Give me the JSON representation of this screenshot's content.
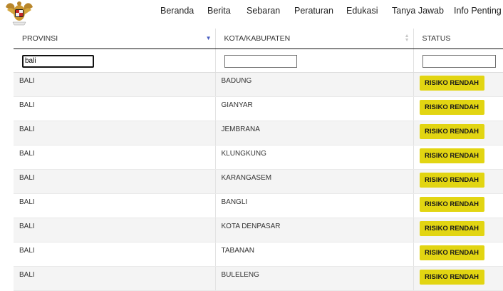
{
  "nav": {
    "items": [
      "Beranda",
      "Berita",
      "Sebaran",
      "Peraturan",
      "Edukasi",
      "Tanya Jawab",
      "Info Penting"
    ]
  },
  "table": {
    "columns": [
      "PROVINSI",
      "KOTA/KABUPATEN",
      "STATUS"
    ],
    "filters": {
      "provinsi": "bali",
      "kota": "",
      "status": ""
    },
    "rows": [
      {
        "provinsi": "BALI",
        "kota": "BADUNG",
        "status": "RISIKO RENDAH"
      },
      {
        "provinsi": "BALI",
        "kota": "GIANYAR",
        "status": "RISIKO RENDAH"
      },
      {
        "provinsi": "BALI",
        "kota": "JEMBRANA",
        "status": "RISIKO RENDAH"
      },
      {
        "provinsi": "BALI",
        "kota": "KLUNGKUNG",
        "status": "RISIKO RENDAH"
      },
      {
        "provinsi": "BALI",
        "kota": "KARANGASEM",
        "status": "RISIKO RENDAH"
      },
      {
        "provinsi": "BALI",
        "kota": "BANGLI",
        "status": "RISIKO RENDAH"
      },
      {
        "provinsi": "BALI",
        "kota": "KOTA DENPASAR",
        "status": "RISIKO RENDAH"
      },
      {
        "provinsi": "BALI",
        "kota": "TABANAN",
        "status": "RISIKO RENDAH"
      },
      {
        "provinsi": "BALI",
        "kota": "BULELENG",
        "status": "RISIKO RENDAH"
      }
    ]
  },
  "colors": {
    "status_low": "#e2d512",
    "sort_active": "#4a5fc1"
  },
  "icons": {
    "logo": "garuda-emblem-icon",
    "sort_active": "sort-descending-icon",
    "sort_inactive": "sort-both-icon"
  }
}
